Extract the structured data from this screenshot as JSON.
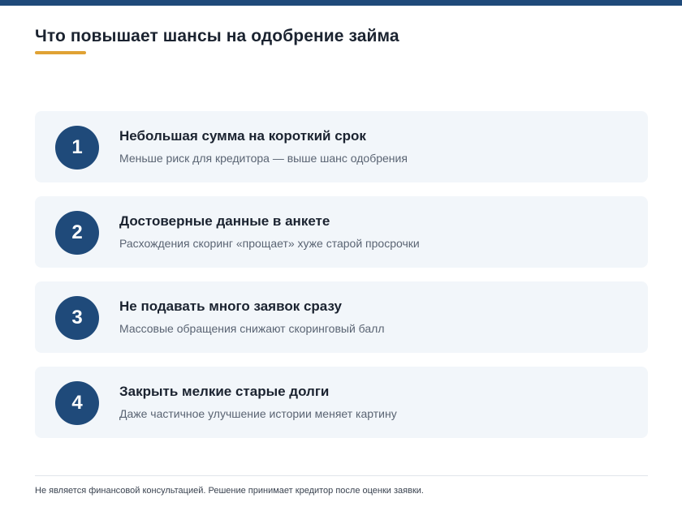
{
  "page": {
    "title": "Что повышает шансы на одобрение займа",
    "footer": "Не является финансовой консультацией. Решение принимает кредитор после оценки заявки."
  },
  "items": [
    {
      "number": "1",
      "title": "Небольшая сумма на короткий срок",
      "description": "Меньше риск для кредитора — выше шанс одобрения"
    },
    {
      "number": "2",
      "title": "Достоверные данные в анкете",
      "description": "Расхождения скоринг «прощает» хуже старой просрочки"
    },
    {
      "number": "3",
      "title": "Не подавать много заявок сразу",
      "description": "Массовые обращения снижают скоринговый балл"
    },
    {
      "number": "4",
      "title": "Закрыть мелкие старые долги",
      "description": "Даже частичное улучшение истории меняет картину"
    }
  ],
  "colors": {
    "accent": "#1f4a7a",
    "highlight": "#e0a234",
    "card_background": "#f2f6fa"
  }
}
